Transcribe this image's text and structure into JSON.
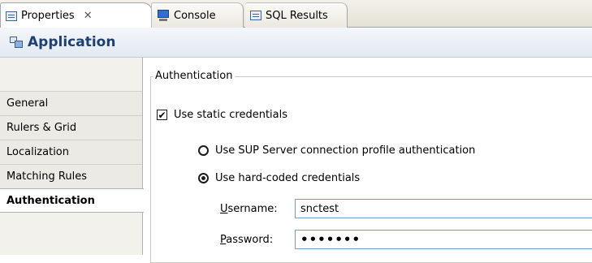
{
  "tabs": [
    {
      "label": "Properties",
      "close": "✕",
      "icon": "properties-icon"
    },
    {
      "label": "Console",
      "icon": "console-icon"
    },
    {
      "label": "SQL Results",
      "icon": "sql-results-icon"
    }
  ],
  "header": {
    "title": "Application",
    "icon": "application-icon"
  },
  "sidebar": {
    "items": [
      {
        "label": "General"
      },
      {
        "label": "Rulers & Grid"
      },
      {
        "label": "Localization"
      },
      {
        "label": "Matching Rules"
      },
      {
        "label": "Authentication"
      }
    ],
    "selected": "Authentication"
  },
  "authentication": {
    "group_label": "Authentication",
    "static_credentials": {
      "label": "Use static credentials",
      "checked": true,
      "mark": "✔"
    },
    "radio_sup": {
      "label": "Use SUP Server connection profile authentication",
      "selected": false
    },
    "radio_hardcoded": {
      "label": "Use hard-coded credentials",
      "selected": true
    },
    "username": {
      "label_first": "U",
      "label_rest": "sername:",
      "value": "snctest"
    },
    "password": {
      "label_first": "P",
      "label_rest": "assword:",
      "value": "•••••••"
    }
  }
}
